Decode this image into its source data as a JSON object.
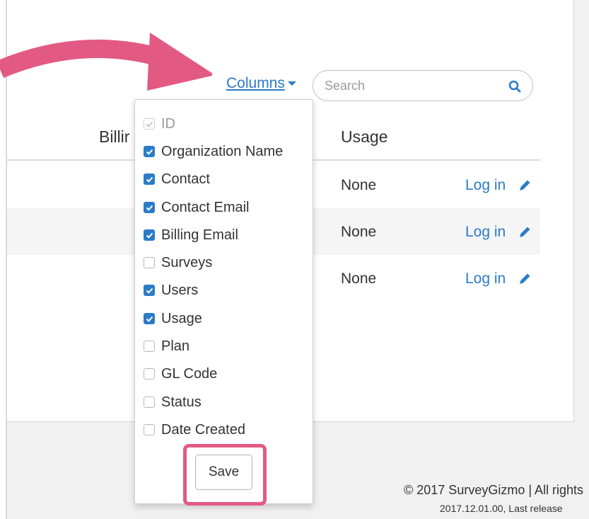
{
  "toolbar": {
    "columns_label": "Columns",
    "search_placeholder": "Search"
  },
  "table": {
    "headers": [
      "Billir",
      "Usage"
    ],
    "rows": [
      {
        "usage": "None",
        "action": "Log in"
      },
      {
        "usage": "None",
        "action": "Log in"
      },
      {
        "usage": "None",
        "action": "Log in"
      }
    ]
  },
  "columns_menu": {
    "options": [
      {
        "label": "ID",
        "checked": true,
        "disabled": true
      },
      {
        "label": "Organization Name",
        "checked": true
      },
      {
        "label": "Contact",
        "checked": true
      },
      {
        "label": "Contact Email",
        "checked": true
      },
      {
        "label": "Billing Email",
        "checked": true
      },
      {
        "label": "Surveys",
        "checked": false
      },
      {
        "label": "Users",
        "checked": true
      },
      {
        "label": "Usage",
        "checked": true
      },
      {
        "label": "Plan",
        "checked": false
      },
      {
        "label": "GL Code",
        "checked": false
      },
      {
        "label": "Status",
        "checked": false
      },
      {
        "label": "Date Created",
        "checked": false
      }
    ],
    "save_label": "Save"
  },
  "footer": {
    "copyright": "© 2017 SurveyGizmo | All rights",
    "version": "2017.12.01.00, Last release"
  },
  "colors": {
    "accent": "#2a7cc7",
    "highlight": "#e25a84"
  },
  "icons": {
    "search": "search-icon",
    "edit": "pencil-icon",
    "dropdown": "caret-down-icon",
    "annotation": "curved-arrow-icon"
  }
}
